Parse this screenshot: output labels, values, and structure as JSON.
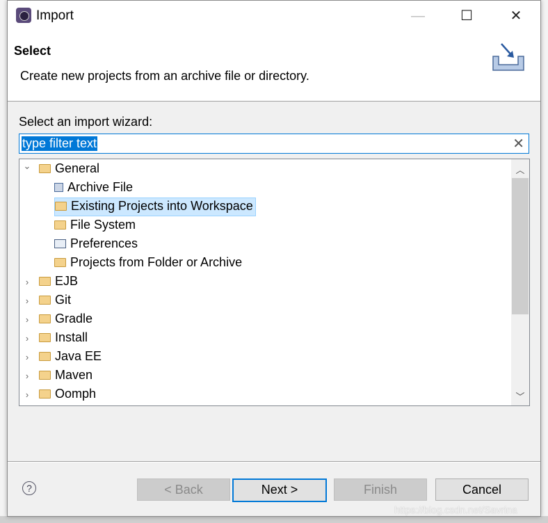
{
  "window": {
    "title": "Import",
    "minimize": "—",
    "maximize": "☐",
    "close": "✕"
  },
  "header": {
    "title": "Select",
    "description": "Create new projects from an archive file or directory."
  },
  "wizard": {
    "label": "Select an import wizard:",
    "filter_value": "type filter text",
    "clear": "✕"
  },
  "tree": [
    {
      "label": "General",
      "expanded": true,
      "icon": "folder-open-icon"
    },
    {
      "label": "Archive File",
      "child": true,
      "icon": "archive-icon"
    },
    {
      "label": "Existing Projects into Workspace",
      "child": true,
      "selected": true,
      "icon": "folder-add-icon"
    },
    {
      "label": "File System",
      "child": true,
      "icon": "folder-icon"
    },
    {
      "label": "Preferences",
      "child": true,
      "icon": "preferences-icon"
    },
    {
      "label": "Projects from Folder or Archive",
      "child": true,
      "icon": "folder-icon"
    },
    {
      "label": "EJB",
      "icon": "folder-open-icon"
    },
    {
      "label": "Git",
      "icon": "folder-open-icon"
    },
    {
      "label": "Gradle",
      "icon": "folder-open-icon"
    },
    {
      "label": "Install",
      "icon": "folder-open-icon"
    },
    {
      "label": "Java EE",
      "icon": "folder-open-icon"
    },
    {
      "label": "Maven",
      "icon": "folder-open-icon"
    },
    {
      "label": "Oomph",
      "icon": "folder-open-icon"
    }
  ],
  "buttons": {
    "help": "?",
    "back": "< Back",
    "next": "Next >",
    "finish": "Finish",
    "cancel": "Cancel"
  },
  "watermark": "https://blog.csdn.net/Savrina",
  "colors": {
    "accent": "#0078d7",
    "selection": "#cce8ff"
  }
}
